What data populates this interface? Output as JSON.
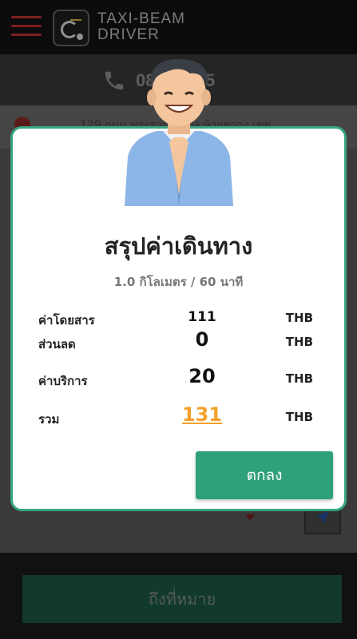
{
  "header": {
    "brand_line1": "TAXI-BEAM",
    "brand_line2": "DRIVER",
    "phone": "08   7-8555"
  },
  "background": {
    "address": "129 ถนน พระราม  แขวง ห้วยขวาง เขต"
  },
  "dialog": {
    "title": "สรุปค่าเดินทาง",
    "subtitle": "1.0 กิโลเมตร / 60 นาที",
    "rows": [
      {
        "label": "ค่าโดยสาร",
        "value": "111",
        "unit": "THB"
      },
      {
        "label": "ส่วนลด",
        "value": "0",
        "unit": "THB"
      },
      {
        "label": "ค่าบริการ",
        "value": "20",
        "unit": "THB"
      },
      {
        "label": "รวม",
        "value": "131",
        "unit": "THB"
      }
    ],
    "ok_label": "ตกลง"
  },
  "bottom": {
    "arrive_label": "ถึงที่หมาย"
  },
  "colors": {
    "accent": "#2fa07c",
    "total": "#f2a12b",
    "menu": "#c03030"
  }
}
